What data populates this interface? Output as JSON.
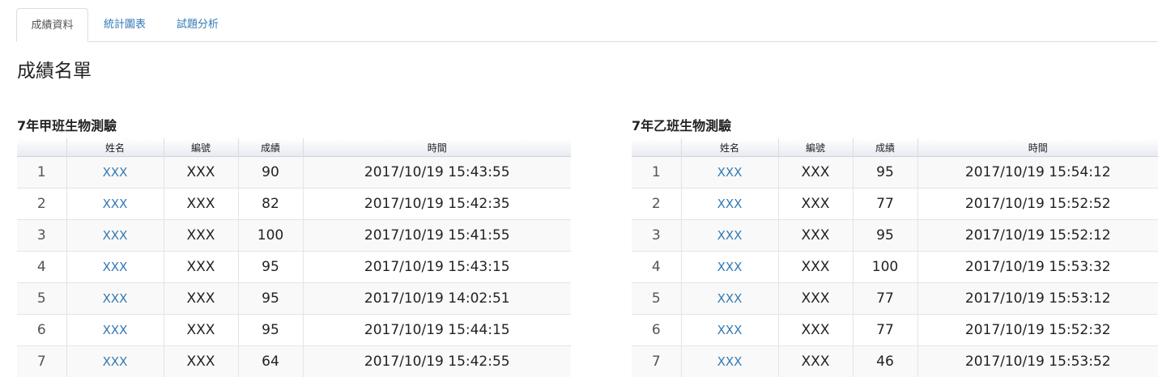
{
  "tabs": [
    {
      "label": "成績資料"
    },
    {
      "label": "統計圖表"
    },
    {
      "label": "試題分析"
    }
  ],
  "page_title": "成績名單",
  "tables": [
    {
      "title": "7年甲班生物測驗",
      "headers": [
        "",
        "姓名",
        "編號",
        "成績",
        "時間"
      ],
      "rows": [
        {
          "no": "1",
          "name": "XXX",
          "id": "XXX",
          "score": "90",
          "time": "2017/10/19 15:43:55"
        },
        {
          "no": "2",
          "name": "XXX",
          "id": "XXX",
          "score": "82",
          "time": "2017/10/19 15:42:35"
        },
        {
          "no": "3",
          "name": "XXX",
          "id": "XXX",
          "score": "100",
          "time": "2017/10/19 15:41:55"
        },
        {
          "no": "4",
          "name": "XXX",
          "id": "XXX",
          "score": "95",
          "time": "2017/10/19 15:43:15"
        },
        {
          "no": "5",
          "name": "XXX",
          "id": "XXX",
          "score": "95",
          "time": "2017/10/19 14:02:51"
        },
        {
          "no": "6",
          "name": "XXX",
          "id": "XXX",
          "score": "95",
          "time": "2017/10/19 15:44:15"
        },
        {
          "no": "7",
          "name": "XXX",
          "id": "XXX",
          "score": "64",
          "time": "2017/10/19 15:42:55"
        }
      ]
    },
    {
      "title": "7年乙班生物測驗",
      "headers": [
        "",
        "姓名",
        "編號",
        "成績",
        "時間"
      ],
      "rows": [
        {
          "no": "1",
          "name": "XXX",
          "id": "XXX",
          "score": "95",
          "time": "2017/10/19 15:54:12"
        },
        {
          "no": "2",
          "name": "XXX",
          "id": "XXX",
          "score": "77",
          "time": "2017/10/19 15:52:52"
        },
        {
          "no": "3",
          "name": "XXX",
          "id": "XXX",
          "score": "95",
          "time": "2017/10/19 15:52:12"
        },
        {
          "no": "4",
          "name": "XXX",
          "id": "XXX",
          "score": "100",
          "time": "2017/10/19 15:53:32"
        },
        {
          "no": "5",
          "name": "XXX",
          "id": "XXX",
          "score": "77",
          "time": "2017/10/19 15:53:12"
        },
        {
          "no": "6",
          "name": "XXX",
          "id": "XXX",
          "score": "77",
          "time": "2017/10/19 15:52:32"
        },
        {
          "no": "7",
          "name": "XXX",
          "id": "XXX",
          "score": "46",
          "time": "2017/10/19 15:53:52"
        }
      ]
    }
  ],
  "colors": {
    "link": "#337ab7",
    "border": "#dddddd",
    "stripe": "#f9f9f9"
  }
}
